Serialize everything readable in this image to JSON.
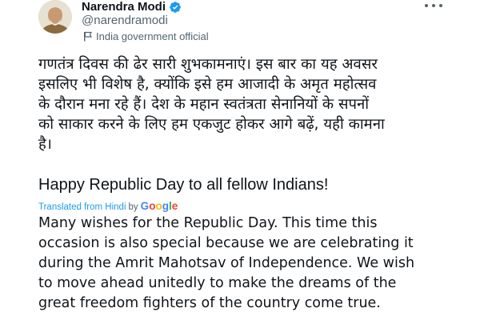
{
  "tweet": {
    "author_name": "Narendra Modi",
    "handle": "@narendramodi",
    "account_label": "India government official",
    "verified_color": "#1d9bf0",
    "hindi_lines": [
      "गणतंत्र दिवस की ढेर सारी शुभकामनाएं। इस बार का यह अवसर",
      "इसलिए भी विशेष है, क्योंकि इसे हम आजादी के अमृत महोत्सव",
      "के दौरान मना रहे हैं। देश के महान स्वतंत्रता सेनानियों के सपनों",
      "को साकार करने के लिए हम एकजुट होकर आगे बढ़ें, यही कामना",
      "है।"
    ],
    "english_line": "Happy Republic Day to all fellow Indians!",
    "translated_prefix": "Translated from Hindi",
    "translated_by": "by",
    "translation_provider": "Google",
    "translation_lines": [
      "Many wishes for the Republic Day. This time this",
      "occasion is also special because we are celebrating it",
      "during the Amrit Mahotsav of Independence. We wish",
      "to move ahead unitedly to make the dreams of the",
      "great freedom fighters of the country come true."
    ]
  },
  "icons": {
    "verified": "verified-badge-icon",
    "government_flag": "flag-icon",
    "more": "more-options-icon"
  }
}
